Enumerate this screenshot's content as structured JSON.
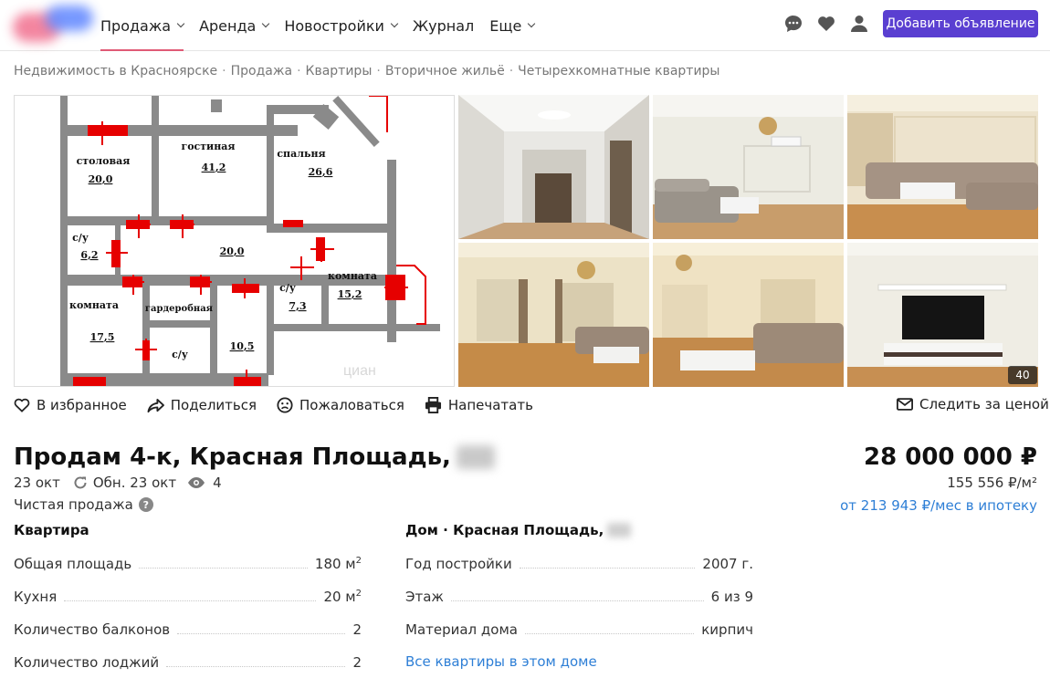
{
  "header": {
    "nav": [
      {
        "label": "Продажа",
        "dropdown": true,
        "active": true
      },
      {
        "label": "Аренда",
        "dropdown": true
      },
      {
        "label": "Новостройки",
        "dropdown": true
      },
      {
        "label": "Журнал",
        "dropdown": false
      },
      {
        "label": "Еще",
        "dropdown": true
      }
    ],
    "icons": [
      "chat-icon",
      "heart-icon",
      "user-icon"
    ],
    "add_button": "Добавить объявление",
    "brand_colors": {
      "accent": "#5a3fd1",
      "active_underline": "#e05a76",
      "link": "#2e7fd6"
    }
  },
  "breadcrumb": [
    "Недвижимость в Красноярске",
    "Продажа",
    "Квартиры",
    "Вторичное жильё",
    "Четырехкомнатные квартиры"
  ],
  "floor_plan": {
    "rooms": [
      {
        "name": "столовая",
        "area": "20,0"
      },
      {
        "name": "гостиная",
        "area": "41,2"
      },
      {
        "name": "спальня",
        "area": "26,6"
      },
      {
        "name": "с/у",
        "area": "6,2"
      },
      {
        "name": "",
        "area": "20,0"
      },
      {
        "name": "с/у",
        "area": "7,3"
      },
      {
        "name": "комната",
        "area": "15,2"
      },
      {
        "name": "комната",
        "area": "17,5"
      },
      {
        "name": "гардеробная",
        "area": ""
      },
      {
        "name": "с/у",
        "area": ""
      },
      {
        "name": "",
        "area": "10,5"
      }
    ],
    "watermark": "циан"
  },
  "gallery": {
    "photo_count_badge": "40"
  },
  "actions": {
    "favorite": "В избранное",
    "share": "Поделиться",
    "report": "Пожаловаться",
    "print": "Напечатать",
    "watch_price": "Следить за ценой"
  },
  "listing": {
    "title": "Продам 4-к, Красная Площадь,",
    "date": "23 окт",
    "updated": "Обн. 23 окт",
    "views": "4",
    "sale_type": "Чистая продажа",
    "price": "28 000 000 ₽",
    "price_per_m2": "155 556 ₽/м²",
    "mortgage": "от 213 943 ₽/мес в ипотеку"
  },
  "apartment": {
    "title": "Квартира",
    "rows": [
      {
        "label": "Общая площадь",
        "value": "180 м",
        "sup": "2"
      },
      {
        "label": "Кухня",
        "value": "20 м",
        "sup": "2"
      },
      {
        "label": "Количество балконов",
        "value": "2",
        "sup": ""
      },
      {
        "label": "Количество лоджий",
        "value": "2",
        "sup": ""
      }
    ]
  },
  "house": {
    "title": "Дом · Красная Площадь,",
    "rows": [
      {
        "label": "Год постройки",
        "value": "2007 г."
      },
      {
        "label": "Этаж",
        "value": "6 из 9"
      },
      {
        "label": "Материал дома",
        "value": "кирпич"
      }
    ],
    "link": "Все квартиры в этом доме"
  }
}
